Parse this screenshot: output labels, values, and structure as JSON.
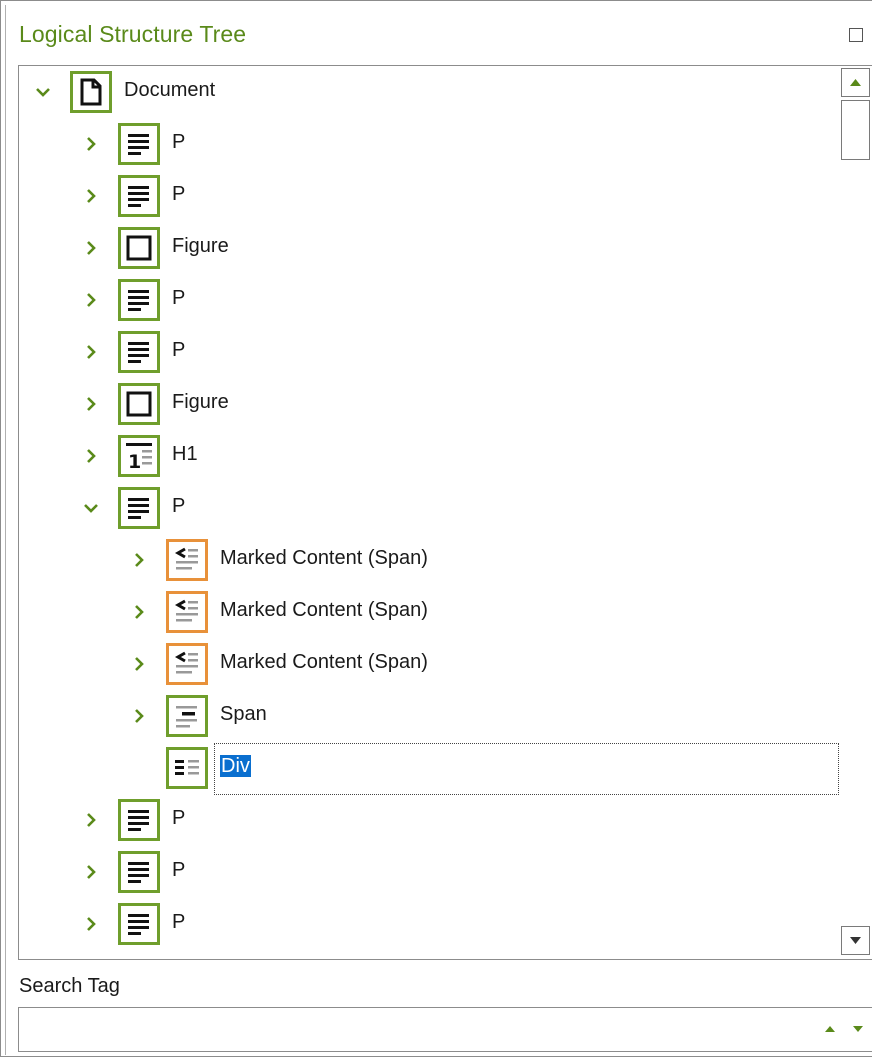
{
  "panel": {
    "title": "Logical Structure Tree",
    "restore_icon": "restore-window-icon"
  },
  "colors": {
    "title": "#5a8a1a",
    "chevron": "#5a8a1a",
    "icon_border_green": "#6f9e2c",
    "icon_border_orange": "#e8913a",
    "selection": "#0a6fcf"
  },
  "tree": {
    "nodes": [
      {
        "label": "Document",
        "icon": "document-icon",
        "expanded": true,
        "has_children": true,
        "level": 0
      },
      {
        "label": "P",
        "icon": "paragraph-icon",
        "expanded": false,
        "has_children": true,
        "level": 1
      },
      {
        "label": "P",
        "icon": "paragraph-icon",
        "expanded": false,
        "has_children": true,
        "level": 1
      },
      {
        "label": "Figure",
        "icon": "figure-icon",
        "expanded": false,
        "has_children": true,
        "level": 1
      },
      {
        "label": "P",
        "icon": "paragraph-icon",
        "expanded": false,
        "has_children": true,
        "level": 1
      },
      {
        "label": "P",
        "icon": "paragraph-icon",
        "expanded": false,
        "has_children": true,
        "level": 1
      },
      {
        "label": "Figure",
        "icon": "figure-icon",
        "expanded": false,
        "has_children": true,
        "level": 1
      },
      {
        "label": "H1",
        "icon": "heading-icon",
        "expanded": false,
        "has_children": true,
        "level": 1
      },
      {
        "label": "P",
        "icon": "paragraph-icon",
        "expanded": true,
        "has_children": true,
        "level": 1
      },
      {
        "label": "Marked Content (Span)",
        "icon": "marked-content-icon",
        "expanded": false,
        "has_children": true,
        "level": 2
      },
      {
        "label": "Marked Content (Span)",
        "icon": "marked-content-icon",
        "expanded": false,
        "has_children": true,
        "level": 2
      },
      {
        "label": "Marked Content (Span)",
        "icon": "marked-content-icon",
        "expanded": false,
        "has_children": true,
        "level": 2
      },
      {
        "label": "Span",
        "icon": "span-icon",
        "expanded": false,
        "has_children": true,
        "level": 2
      },
      {
        "label": "Div",
        "icon": "div-icon",
        "expanded": false,
        "has_children": false,
        "level": 2,
        "selected": true
      },
      {
        "label": "P",
        "icon": "paragraph-icon",
        "expanded": false,
        "has_children": true,
        "level": 1
      },
      {
        "label": "P",
        "icon": "paragraph-icon",
        "expanded": false,
        "has_children": true,
        "level": 1
      },
      {
        "label": "P",
        "icon": "paragraph-icon",
        "expanded": false,
        "has_children": true,
        "level": 1
      }
    ]
  },
  "search": {
    "label": "Search Tag",
    "value": "",
    "placeholder": "",
    "prev_icon": "arrow-up-icon",
    "next_icon": "arrow-down-icon"
  }
}
